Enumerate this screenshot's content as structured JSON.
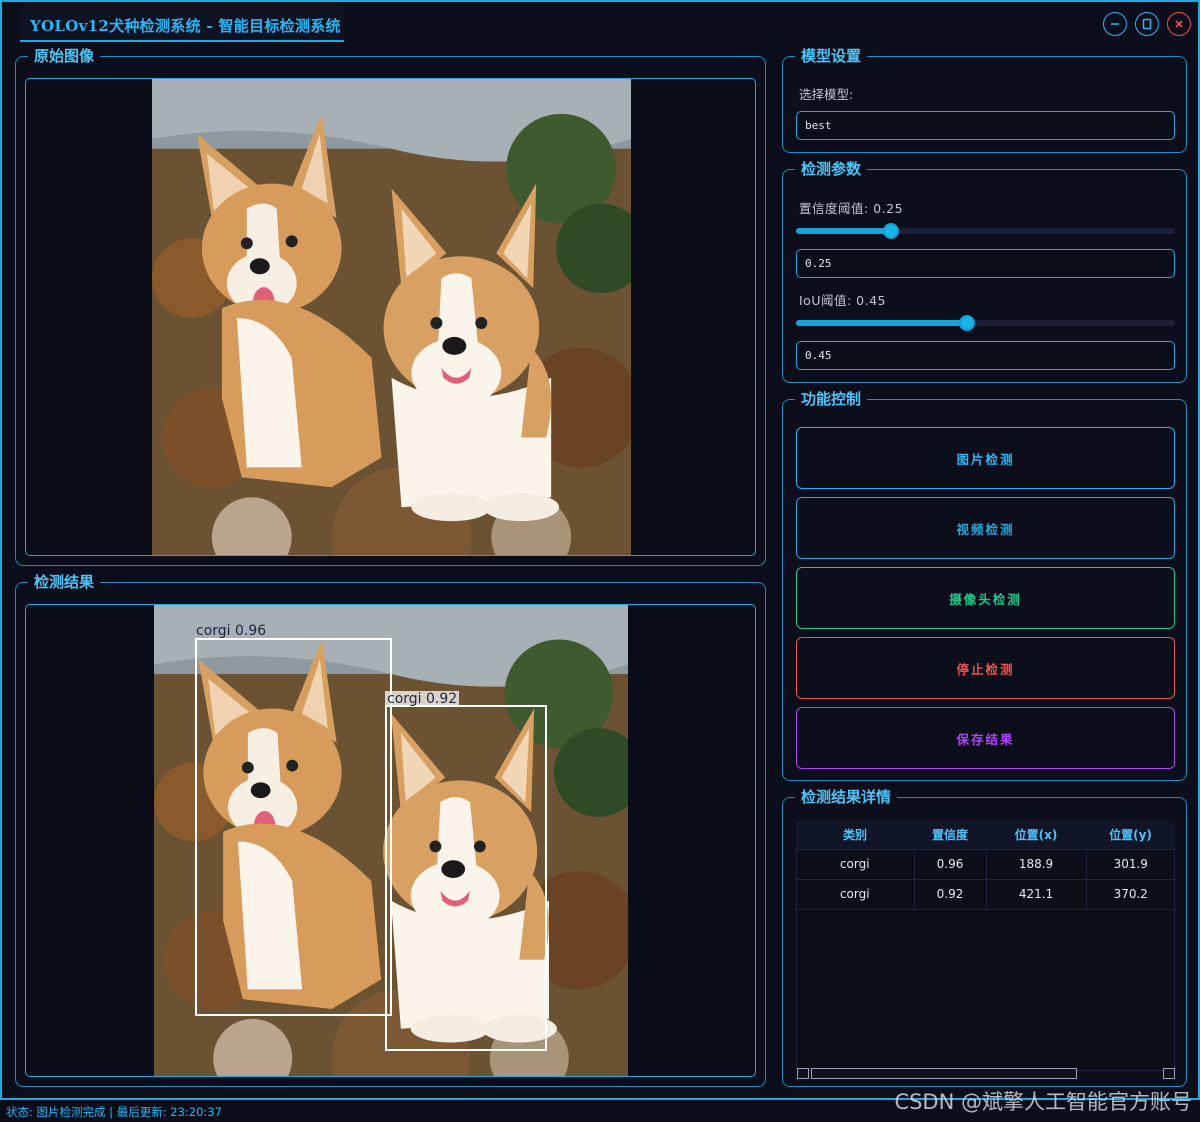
{
  "window": {
    "title": "YOLOv12犬种检测系统 - 智能目标检测系统",
    "controls": [
      "minimize-icon",
      "maximize-icon",
      "close-icon"
    ],
    "accent_color": "#1fa9e0"
  },
  "original_panel": {
    "title": "原始图像"
  },
  "result_panel": {
    "title": "检测结果",
    "detections": [
      {
        "label": "corgi 0.96"
      },
      {
        "label": "corgi 0.92"
      }
    ]
  },
  "model_settings": {
    "title": "模型设置",
    "select_label": "选择模型:",
    "selected_model": "best"
  },
  "params": {
    "title": "检测参数",
    "confidence_label": "置信度阈值: 0.25",
    "confidence_value": "0.25",
    "confidence_fraction": 0.25,
    "iou_label": "IoU阈值: 0.45",
    "iou_value": "0.45",
    "iou_fraction": 0.45
  },
  "controls": {
    "title": "功能控制",
    "buttons": [
      {
        "label": "图片检测",
        "color": "#29b6f6"
      },
      {
        "label": "视频检测",
        "color": "#26a6d9"
      },
      {
        "label": "摄像头检测",
        "color": "#1ec98b"
      },
      {
        "label": "停止检测",
        "color": "#ef5350"
      },
      {
        "label": "保存结果",
        "color": "#ab47f0"
      }
    ]
  },
  "details": {
    "title": "检测结果详情",
    "columns": [
      "类别",
      "置信度",
      "位置(x)",
      "位置(y)"
    ],
    "rows": [
      [
        "corgi",
        "0.96",
        "188.9",
        "301.9"
      ],
      [
        "corgi",
        "0.92",
        "421.1",
        "370.2"
      ]
    ]
  },
  "status": {
    "text": "状态: 图片检测完成 | 最后更新: 23:20:37"
  },
  "watermark": "CSDN @斌擎人工智能官方账号"
}
